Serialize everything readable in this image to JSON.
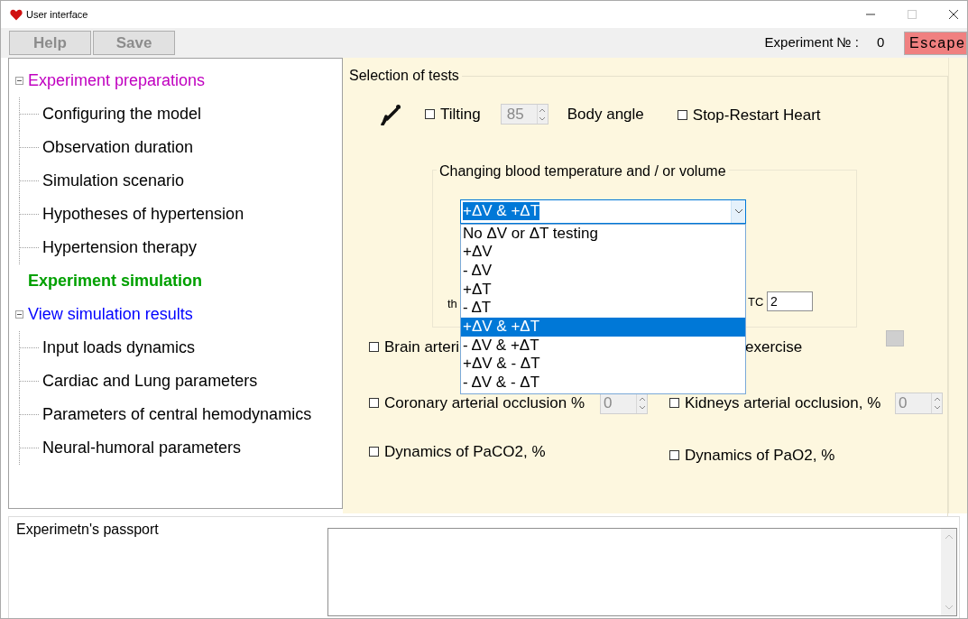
{
  "window": {
    "title": "User interface"
  },
  "toolbar": {
    "buttons": [
      {
        "label": "Help",
        "disabled": true
      },
      {
        "label": "Save",
        "disabled": true
      }
    ],
    "experiment_label": "Experiment № :",
    "experiment_number": "0",
    "escape_button": "Escape"
  },
  "tree": [
    {
      "label": "Experiment preparations",
      "color": "#c000c0",
      "selected": false,
      "expanded": true,
      "children": [
        {
          "label": "Configuring the model"
        },
        {
          "label": "Observation duration"
        },
        {
          "label": "Simulation scenario"
        },
        {
          "label": "Hypotheses of hypertension"
        },
        {
          "label": "Hypertension therapy"
        }
      ]
    },
    {
      "label": "Experiment simulation",
      "color": "#00a000",
      "selected": true
    },
    {
      "label": "View simulation results",
      "color": "#0000ff",
      "selected": false,
      "expanded": true,
      "children": [
        {
          "label": "Input loads dynamics"
        },
        {
          "label": "Cardiac and Lung parameters"
        },
        {
          "label": "Parameters of central hemodynamics"
        },
        {
          "label": "Neural-humoral parameters"
        }
      ]
    }
  ],
  "tests": {
    "title": "Selection of tests",
    "tilting": {
      "label": "Tilting",
      "checked": false,
      "angle": "85",
      "angle_label": "Body angle"
    },
    "stop_restart": {
      "label": "Stop-Restart Heart",
      "checked": false
    },
    "blood": {
      "title": "Changing blood temperature and / or volume",
      "combo_value": "+ΔV & +ΔT",
      "column_1": "th",
      "column_2": "TC",
      "field_value": "2",
      "options": [
        {
          "label": "No ΔV or ΔT testing",
          "selected": false
        },
        {
          "label": "+ΔV",
          "selected": false
        },
        {
          "label": "- ΔV",
          "selected": false
        },
        {
          "label": "+ΔT",
          "selected": false
        },
        {
          "label": "- ΔT",
          "selected": false
        },
        {
          "label": "+ΔV & +ΔT",
          "selected": true
        },
        {
          "label": "- ΔV & +ΔT",
          "selected": false
        },
        {
          "label": "+ΔV & - ΔT",
          "selected": false
        },
        {
          "label": "- ΔV & - ΔT",
          "selected": false
        }
      ]
    },
    "brain": {
      "label": "Brain arteri",
      "checked": false
    },
    "exercise": {
      "label": "exercise"
    },
    "coronary": {
      "label": "Coronary arterial occlusion %",
      "checked": false,
      "value": "0"
    },
    "kidneys": {
      "label": "Kidneys arterial occlusion, %",
      "checked": false,
      "value": "0"
    },
    "paco2": {
      "label": "Dynamics of PaCO2, %",
      "checked": false
    },
    "pao2": {
      "label": "Dynamics of  PaO2, %",
      "checked": false
    }
  },
  "passport": {
    "title": "Experimetn's passport"
  }
}
